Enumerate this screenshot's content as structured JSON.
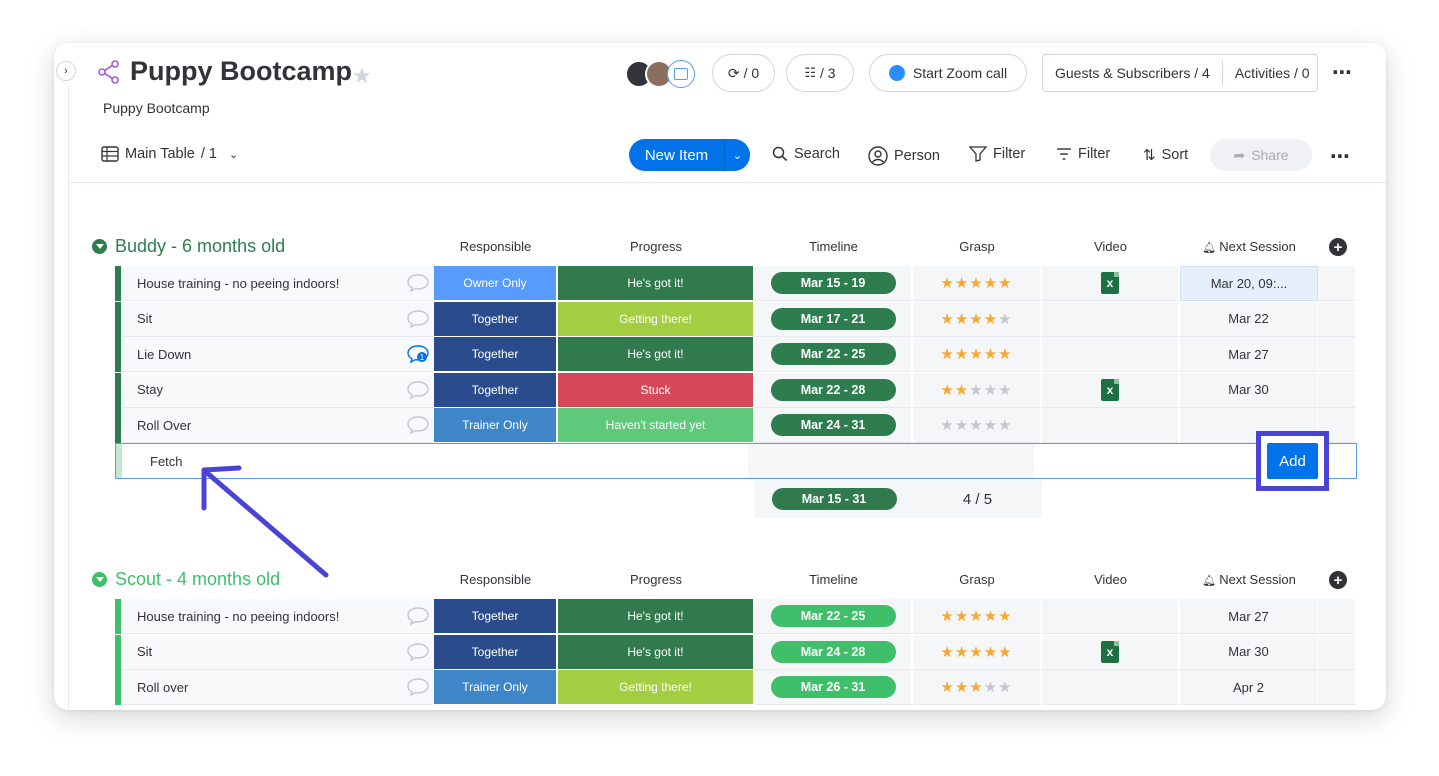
{
  "header": {
    "title": "Puppy Bootcamp",
    "description": "Puppy Bootcamp",
    "updates_count": "/ 0",
    "automations_count": "/ 3",
    "zoom_label": "Start Zoom call",
    "guests_label": "Guests & Subscribers / 4",
    "activities_label": "Activities / 0"
  },
  "toolbar": {
    "view_label": "Main Table",
    "view_count": "/ 1",
    "new_item_label": "New Item",
    "search_label": "Search",
    "person_label": "Person",
    "filter_label": "Filter",
    "filter2_label": "Filter",
    "sort_label": "Sort",
    "share_label": "Share"
  },
  "columns": [
    "Responsible",
    "Progress",
    "Timeline",
    "Grasp",
    "Video",
    "Next Session"
  ],
  "colors": {
    "group1": "#2e7d4f",
    "group2": "#3fbf6a",
    "primary": "#0073ea",
    "owner_only": "#579bfc",
    "together": "#2b4c8c",
    "trainer_only": "#3f86c8",
    "got_it": "#317a4e",
    "getting_there": "#a4cd42",
    "stuck": "#d6495a",
    "not_started": "#5ec97a"
  },
  "groups": [
    {
      "title": "Buddy - 6 months old",
      "rows": [
        {
          "name": "House training - no peeing indoors!",
          "responsible": "Owner Only",
          "progress": "He's got it!",
          "timeline": "Mar 15 - 19",
          "grasp": 5,
          "video": true,
          "next": "Mar 20, 09:...",
          "comments": ""
        },
        {
          "name": "Sit",
          "responsible": "Together",
          "progress": "Getting there!",
          "timeline": "Mar 17 - 21",
          "grasp": 4,
          "video": false,
          "next": "Mar 22",
          "comments": ""
        },
        {
          "name": "Lie Down",
          "responsible": "Together",
          "progress": "He's got it!",
          "timeline": "Mar 22 - 25",
          "grasp": 5,
          "video": false,
          "next": "Mar 27",
          "comments": "1"
        },
        {
          "name": "Stay",
          "responsible": "Together",
          "progress": "Stuck",
          "timeline": "Mar 22 - 28",
          "grasp": 2,
          "video": true,
          "next": "Mar 30",
          "comments": ""
        },
        {
          "name": "Roll Over",
          "responsible": "Trainer Only",
          "progress": "Haven't started yet",
          "timeline": "Mar 24 - 31",
          "grasp": 0,
          "video": false,
          "next": "",
          "comments": ""
        }
      ],
      "new_item_value": "Fetch",
      "add_label": "Add",
      "summary_timeline": "Mar 15 - 31",
      "summary_grasp": "4 / 5"
    },
    {
      "title": "Scout - 4 months old",
      "rows": [
        {
          "name": "House training - no peeing indoors!",
          "responsible": "Together",
          "progress": "He's got it!",
          "timeline": "Mar 22 - 25",
          "grasp": 5,
          "video": false,
          "next": "Mar 27",
          "comments": ""
        },
        {
          "name": "Sit",
          "responsible": "Together",
          "progress": "He's got it!",
          "timeline": "Mar 24 - 28",
          "grasp": 5,
          "video": true,
          "next": "Mar 30",
          "comments": ""
        },
        {
          "name": "Roll over",
          "responsible": "Trainer Only",
          "progress": "Getting there!",
          "timeline": "Mar 26 - 31",
          "grasp": 3,
          "video": false,
          "next": "Apr 2",
          "comments": ""
        }
      ]
    }
  ]
}
